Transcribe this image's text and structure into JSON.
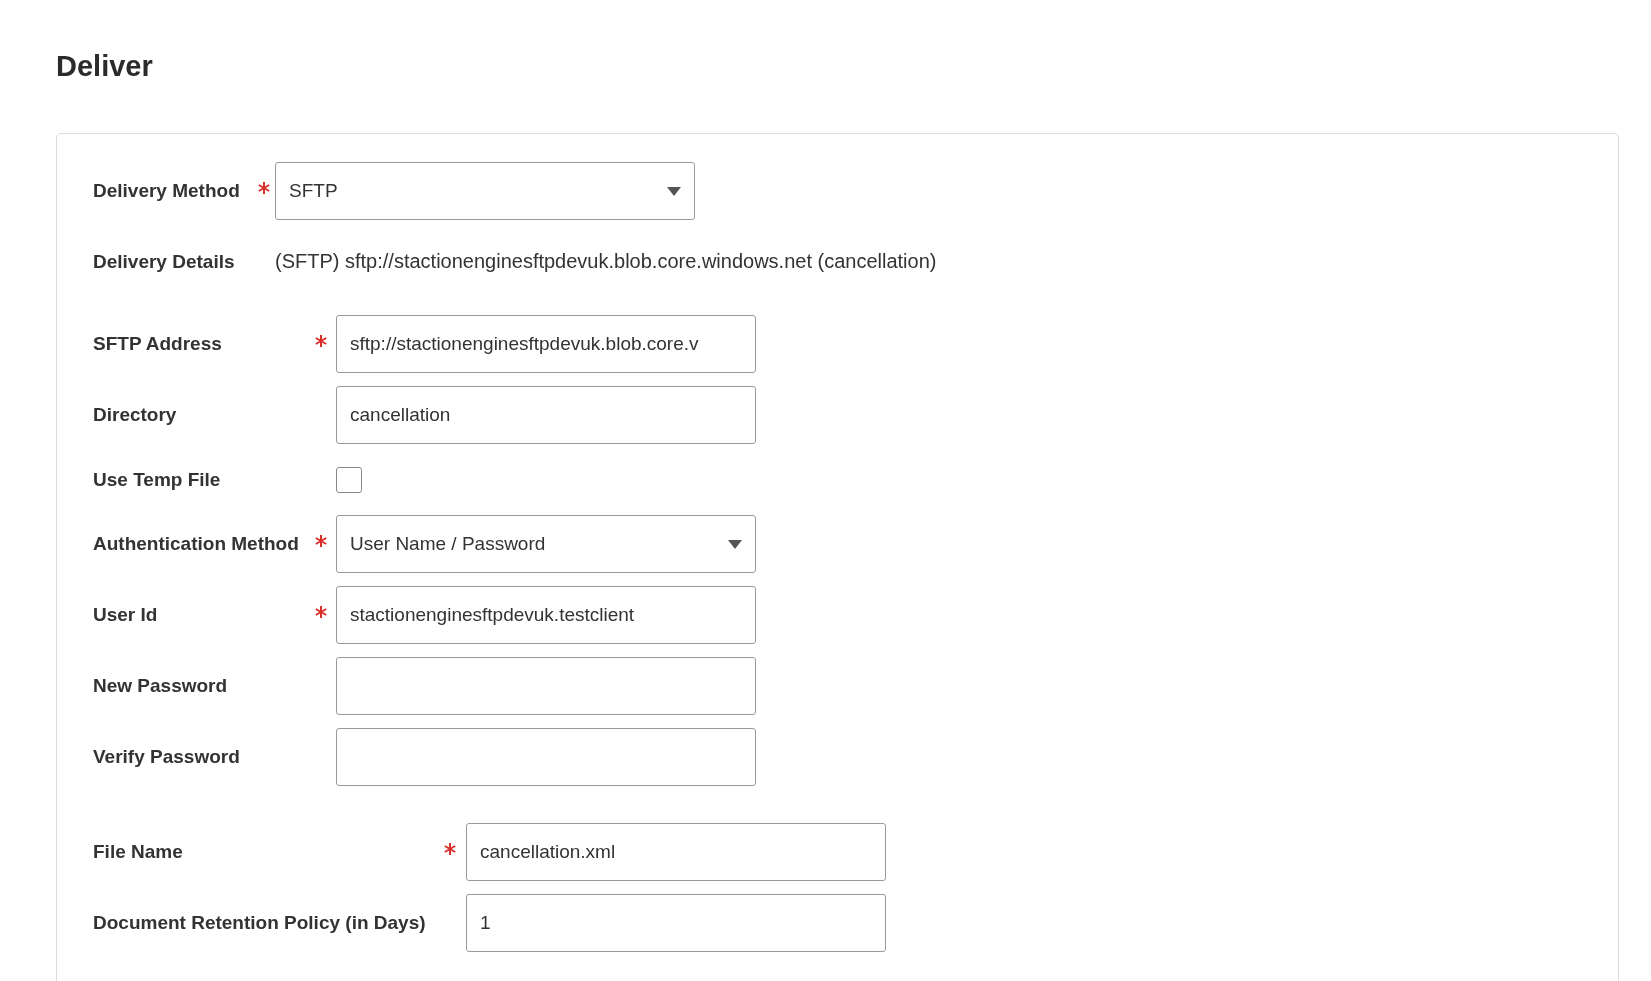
{
  "title": "Deliver",
  "delivery": {
    "method": {
      "label": "Delivery Method",
      "required": true,
      "kind": "select",
      "value": "SFTP"
    },
    "details": {
      "label": "Delivery Details",
      "value": "(SFTP) sftp://stactionenginesftpdevuk.blob.core.windows.net (cancellation)"
    }
  },
  "sftp_fields": [
    {
      "kind": "text",
      "label": "SFTP Address",
      "required": true,
      "value": "sftp://stactionenginesftpdevuk.blob.core.v"
    },
    {
      "kind": "text",
      "label": "Directory",
      "required": false,
      "value": "cancellation"
    },
    {
      "kind": "checkbox",
      "label": "Use Temp File",
      "required": false,
      "checked": false
    },
    {
      "kind": "select",
      "label": "Authentication Method",
      "required": true,
      "value": "User Name / Password"
    },
    {
      "kind": "text",
      "label": "User Id",
      "required": true,
      "value": "stactionenginesftpdevuk.testclient"
    },
    {
      "kind": "text",
      "label": "New Password",
      "required": false
    },
    {
      "kind": "text",
      "label": "Verify Password",
      "required": false
    }
  ],
  "file_fields": [
    {
      "kind": "text",
      "label": "File Name",
      "required": true,
      "value": "cancellation.xml"
    },
    {
      "kind": "text",
      "label": "Document Retention Policy (in Days)",
      "required": false,
      "value": "1"
    }
  ]
}
